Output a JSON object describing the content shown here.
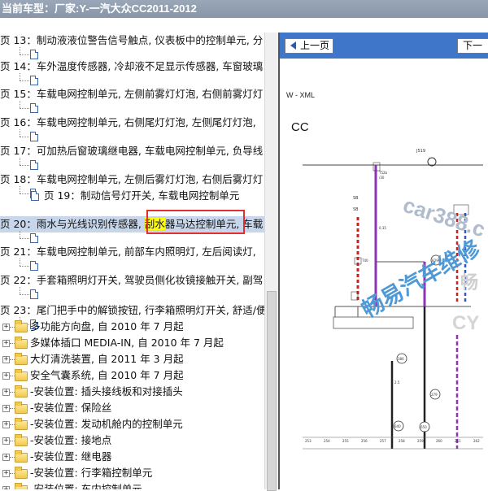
{
  "header": {
    "label": "当前车型：",
    "model": "厂家:Y-一汽大众CC2011-2012"
  },
  "tree": {
    "doc_items": [
      {
        "text": "页 13：制动液液位警告信号触点, 仪表板中的控制单元, 分"
      },
      {
        "text": "页 14：车外温度传感器, 冷却液不足显示传感器, 车窗玻璃"
      },
      {
        "text": "页 15：车载电网控制单元, 左侧前雾灯灯泡, 右侧前雾灯灯"
      },
      {
        "text": "页 16：车载电网控制单元, 右侧尾灯灯泡, 左侧尾灯灯泡,"
      },
      {
        "text": "页 17：可加热后窗玻璃继电器, 车载电网控制单元, 负导线"
      },
      {
        "text": "页 18：车载电网控制单元, 左侧后雾灯灯泡, 右侧后雾灯灯"
      },
      {
        "text": "页 19：制动信号灯开关, 车载电网控制单元"
      },
      {
        "text_before": "页 20：雨水与光线识别传感器, ",
        "text_highlight": "刮水",
        "text_after": "器马达控制单元, 车载"
      },
      {
        "text": "页 21：车载电网控制单元, 前部车内照明灯, 左后阅读灯,"
      },
      {
        "text": "页 22：手套箱照明灯开关, 驾驶员侧化妆镜接触开关, 副驾"
      },
      {
        "text": "页 23：尾门把手中的解锁按钮, 行李箱照明灯开关, 舒适/便"
      }
    ],
    "folders": [
      {
        "text": "多功能方向盘, 自 2010 年 7 月起"
      },
      {
        "text": "多媒体插口 MEDIA-IN, 自 2010 年 7 月起"
      },
      {
        "text": "大灯清洗装置, 自 2011 年 3 月起"
      },
      {
        "text": "安全气囊系统, 自 2010 年 7 月起"
      },
      {
        "text": "-安装位置: 插头接线板和对接插头"
      },
      {
        "text": "-安装位置: 保险丝"
      },
      {
        "text": "-安装位置: 发动机舱内的控制单元"
      },
      {
        "text": "-安装位置: 接地点"
      },
      {
        "text": "-安装位置: 继电器"
      },
      {
        "text": "-安装位置: 行李箱控制单元"
      },
      {
        "text": "-安装位置: 车内控制单元"
      }
    ]
  },
  "viewer": {
    "prev_label": "上一页",
    "next_label": "下一",
    "doc_code": "W - XML",
    "doc_model": "CC",
    "watermark1": "car388.c",
    "watermark2": "畅易汽车维修",
    "watermark3": "CY",
    "watermark4": "畅"
  },
  "colors": {
    "titlebar": "#8f9cae",
    "pager_bar": "#3f76c9",
    "row_highlight": "#c7d6ea",
    "word_highlight": "#ffff00",
    "red_box": "#e03030",
    "wire_violet": "#8e35b5"
  }
}
